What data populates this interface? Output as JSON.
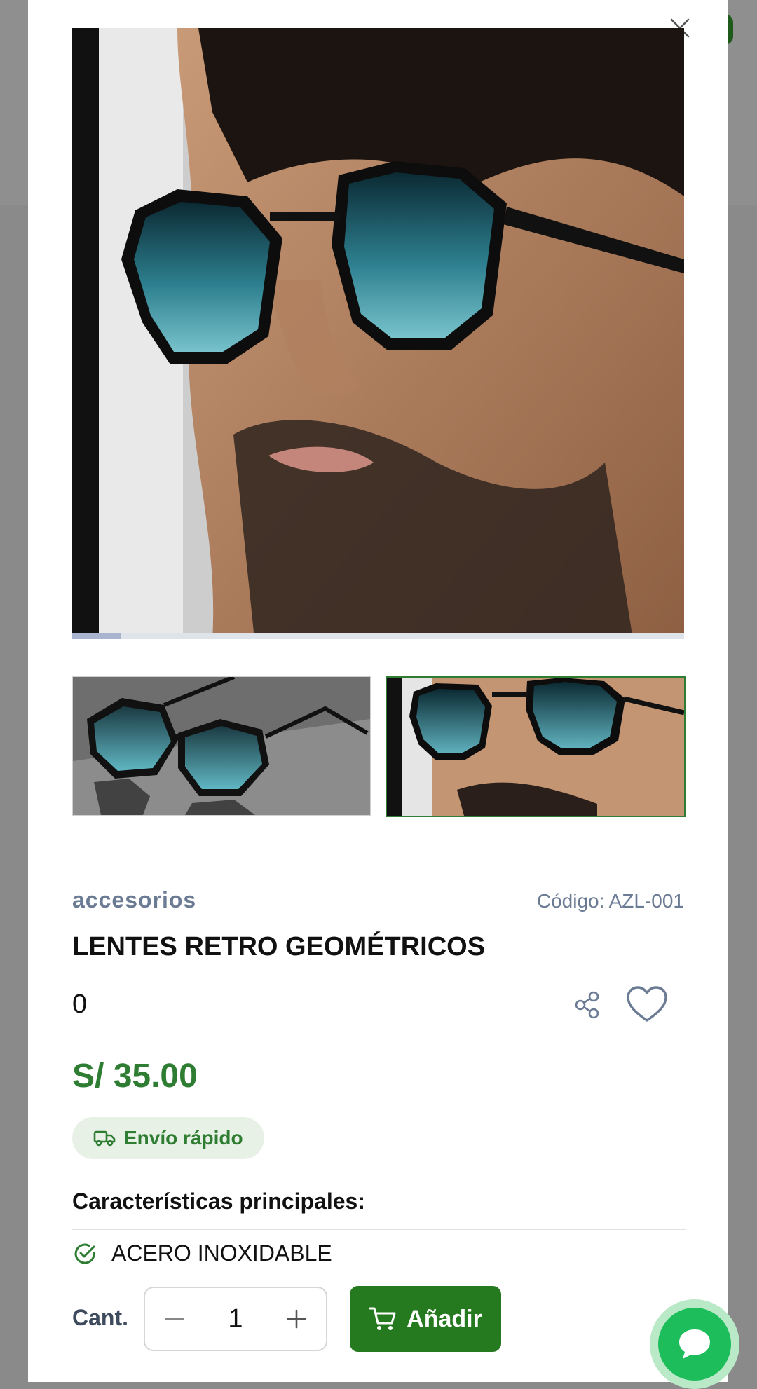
{
  "product": {
    "category": "accesorios",
    "code_label": "Código: AZL-001",
    "title": "LENTES RETRO GEOMÉTRICOS",
    "rating_count": "0",
    "price": "S/ 35.00",
    "shipping_badge": "Envío rápido",
    "features_title": "Características principales:",
    "features": [
      "ACERO INOXIDABLE"
    ]
  },
  "gallery": {
    "progress": 0.08,
    "thumbnails": [
      "sunglasses-product-photo",
      "model-wearing-sunglasses"
    ],
    "selected_thumbnail": 1
  },
  "cart": {
    "qty_label": "Cant.",
    "quantity": "1",
    "add_label": "Añadir"
  },
  "colors": {
    "accent": "#2e7d32",
    "button": "#257a1f",
    "chat": "#1ebd5b"
  },
  "icons": {
    "close": "close-icon",
    "share": "share-icon",
    "favorite": "heart-icon",
    "shipping": "truck-icon",
    "feature": "check-circle-icon",
    "minus": "minus-icon",
    "plus": "plus-icon",
    "cart": "cart-icon",
    "chat": "chat-bubble-icon"
  }
}
